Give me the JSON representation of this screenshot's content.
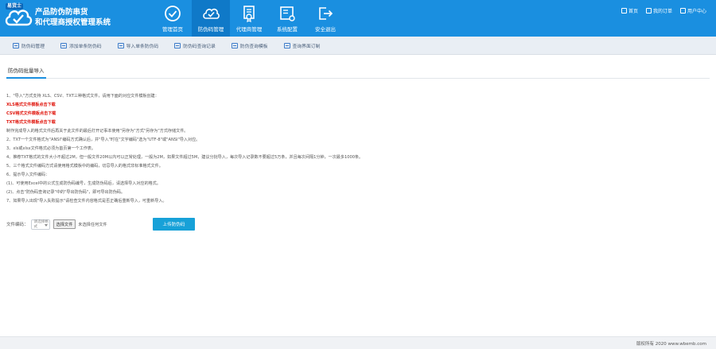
{
  "brand": {
    "logo_tag": "易货士",
    "title_line1": "产品防伪防串货",
    "title_line2": "和代理商授权管理系统"
  },
  "topnav": [
    {
      "label": "管理首页",
      "icon": "check-circle-icon",
      "active": false
    },
    {
      "label": "防伪码管理",
      "icon": "cloud-check-icon",
      "active": true
    },
    {
      "label": "代理商管理",
      "icon": "certificate-icon",
      "active": false
    },
    {
      "label": "系统配置",
      "icon": "system-config-icon",
      "active": false
    },
    {
      "label": "安全退出",
      "icon": "logout-icon",
      "active": false
    }
  ],
  "toplinks": {
    "home": "首页",
    "orders": "我的订单",
    "user_center": "用户中心"
  },
  "subnav": [
    {
      "label": "防伪码管理",
      "icon": "list-icon"
    },
    {
      "label": "添加单条防伪码",
      "icon": "add-icon"
    },
    {
      "label": "导入单条防伪码",
      "icon": "import-icon"
    },
    {
      "label": "防伪码查询记录",
      "icon": "record-icon"
    },
    {
      "label": "防伪查询模板",
      "icon": "template-icon"
    },
    {
      "label": "查询界面订制",
      "icon": "customize-icon"
    }
  ],
  "tab": {
    "label": "防伪码批量导入"
  },
  "notes": [
    {
      "text": "1、\"导入\"方式支持 XLS、CSV、TXT三种格式文件，请用下面的对应文件模板创建：",
      "red": false
    },
    {
      "text": "XLS格式文件模板点击下载",
      "red": true
    },
    {
      "text": "CSV格式文件模板点击下载",
      "red": true
    },
    {
      "text": "TXT格式文件模板点击下载",
      "red": true
    },
    {
      "text": "制作完成导入的格式文件后再关于此文件的最后打开记事本使用\"另存为\"方式\"另存为\"方式存储文件。",
      "red": false
    },
    {
      "text": "2、TXT一个文件格式为\"ANSI\"编码方式确认后，并\"导入\"时在\"文字编码\"选为\"UTF-8\"或\"ANSI\"导入对应。",
      "red": false
    },
    {
      "text": "3、xls或xlsx文件格式必须为首页第一个工作表。",
      "red": false
    },
    {
      "text": "4、推荐TXT格式的文件大小不超过2M，但一般文件20M以内可以正常处理，一般为2M，如果文件超过5M，建议分批导入，每次导入记录数不要超过5万条，并且每次间隔1分钟，一次最多1000条。",
      "red": false
    },
    {
      "text": "5、三个格式文件编码方式请使用格式模板中的编码，切忌导入的格式非标准格式文件。",
      "red": false
    },
    {
      "text": "6、提示导入文件编码：",
      "red": false
    },
    {
      "text": "(1)、可使用Excel中的公式生成防伪码编号，生成防伪码后，请选择导入对应的格式。",
      "red": false
    },
    {
      "text": "(2)、点击\"防伪码查询记录\"中的\"导出防伪码\"，即可导出防伪码。",
      "red": false
    },
    {
      "text": "7、如果导入出现\"导入失败提示\"请检查文件内容格式是否正确后重新导入，可重新导入。",
      "red": false
    }
  ],
  "upload": {
    "label": "文件编码：",
    "select_value": "请选择格式",
    "file_button": "选择文件",
    "file_status": "未选择任何文件",
    "submit": "上传防伪码"
  },
  "footer": {
    "copyright": "版权所有 2020 www.wbemb.com"
  },
  "colors": {
    "header": "#1a8fe0",
    "active_nav": "#0f79c8",
    "red_link": "#e0160d",
    "upload_button": "#17a1d8"
  }
}
